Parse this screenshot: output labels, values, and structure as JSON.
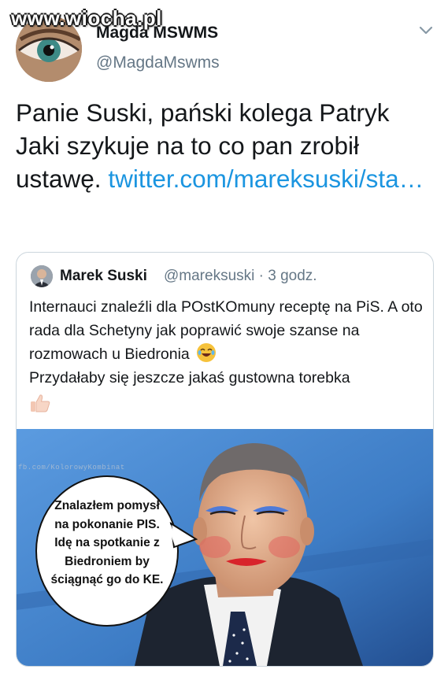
{
  "watermark": "www.wiocha.pl",
  "author": {
    "name": "Magda MSWMS",
    "handle": "@MagdaMswms"
  },
  "tweet": {
    "text": "Panie Suski, pański kolega Patryk Jaki szykuje na to co pan zrobił ustawę.",
    "link": "twitter.com/mareksuski/sta…"
  },
  "quoted": {
    "name": "Marek Suski",
    "handle": "@mareksuski · 3 godz.",
    "text": "Internauci znaleźli dla POstKOmuny receptę na PiS. A oto rada dla Schetyny jak poprawić swoje szanse na rozmowach u Biedronia",
    "text2": "Przydałaby się jeszcze jakaś gustowna torebka",
    "image": {
      "bubble_text": "Znalazłem pomysł na pokonanie PIS. Idę na spotkanie z Biedroniem by ściągnąć go do KE.",
      "watermark": "fb.com/KolorowyKombinat"
    }
  },
  "icons": {
    "more": "chevron-down-icon",
    "laugh": "tears-of-joy-emoji",
    "thumb": "thumbs-up-emoji"
  },
  "colors": {
    "link": "#1b95e0",
    "secondary_text": "#657786",
    "border": "#ccd6dd",
    "image_background": "#3f7fc4"
  }
}
